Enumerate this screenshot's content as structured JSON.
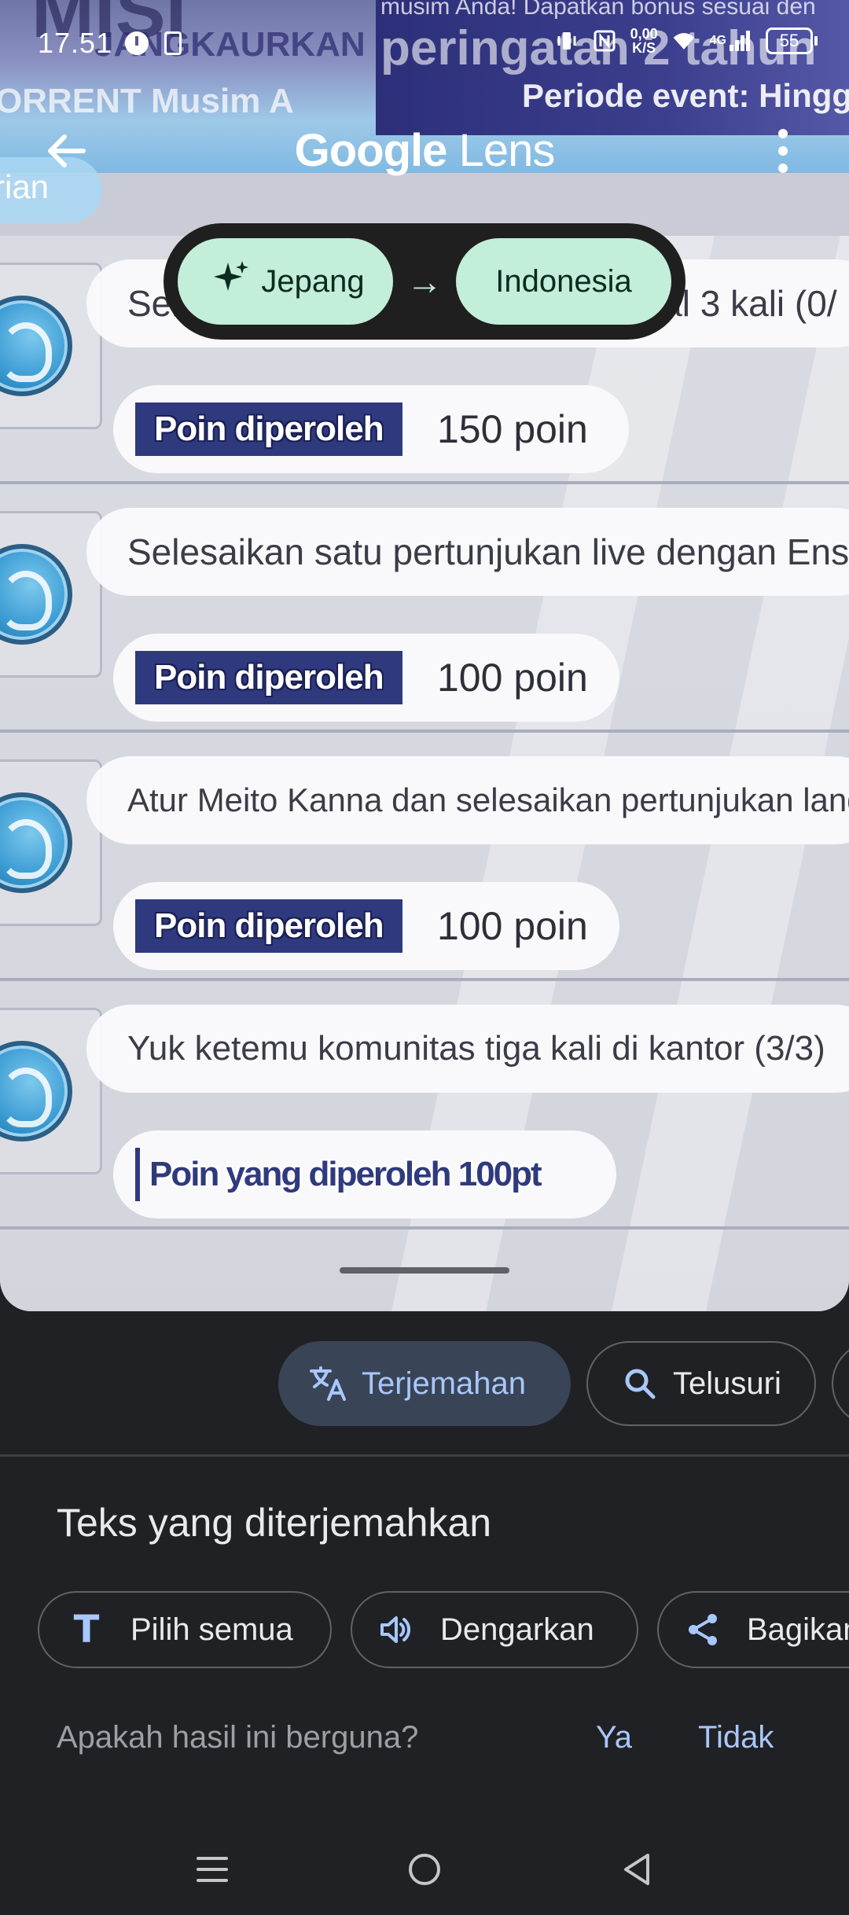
{
  "status_bar": {
    "time": "17.51",
    "net_speed_value": "0,00",
    "net_speed_unit": "K/S",
    "network_type": "4G",
    "battery_level": "55"
  },
  "background_image_text": {
    "misi": "MISI",
    "jangkau": "JANGKAURKAN",
    "torrent": "ORRENT Musim A",
    "musim": "musim Anda! Dapatkan bonus sesuai den",
    "peringatan": "peringatan 2 tahun",
    "periode": "Periode event: Hingga pu",
    "rian": "rian"
  },
  "top_bar": {
    "title_google": "Google",
    "title_lens": "Lens"
  },
  "language_bar": {
    "source": "Jepang",
    "target": "Indonesia",
    "arrow": "→"
  },
  "missions": [
    {
      "title": "Selesaikan siaran langsung normal 3 kali (0/",
      "label": "Poin diperoleh",
      "points": "150 poin"
    },
    {
      "title": "Selesaikan satu pertunjukan live dengan Ens",
      "label": "Poin diperoleh",
      "points": "100 poin"
    },
    {
      "title": "Atur Meito Kanna dan selesaikan pertunjukan langsun",
      "label": "Poin diperoleh",
      "points": "100 poin"
    },
    {
      "title": "Yuk ketemu komunitas tiga kali di kantor (3/3)",
      "label": "Poin yang diperoleh 100pt",
      "points": ""
    }
  ],
  "tabs": {
    "translate": "Terjemahan",
    "search": "Telusuri"
  },
  "panel": {
    "title": "Teks yang diterjemahkan",
    "actions": {
      "select_all": "Pilih semua",
      "listen": "Dengarkan",
      "share": "Bagikan"
    },
    "feedback_question": "Apakah hasil ini berguna?",
    "feedback_yes": "Ya",
    "feedback_no": "Tidak"
  },
  "colors": {
    "accent_blue": "#a8c7fa",
    "chip_green": "#c3eed9",
    "panel_bg": "#202124",
    "active_tab_bg": "#394457",
    "label_bar": "#2f3a7e"
  }
}
